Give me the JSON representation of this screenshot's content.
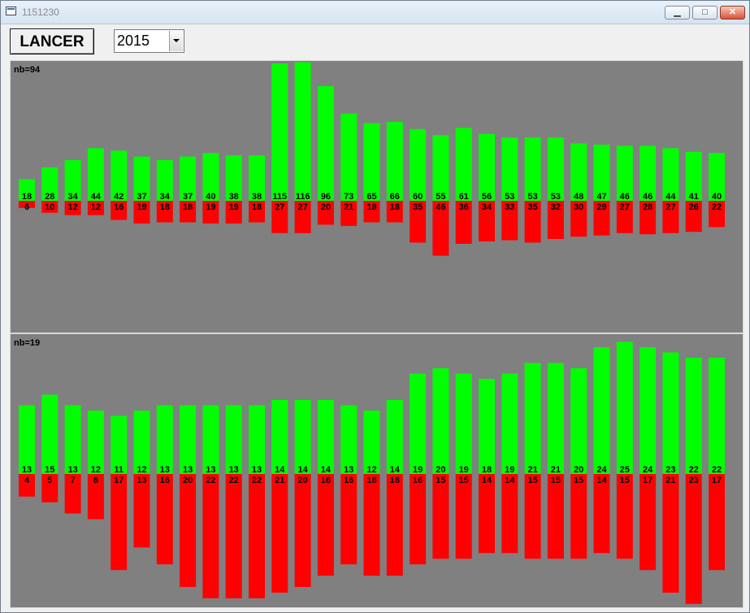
{
  "window": {
    "title": "1151230"
  },
  "toolbar": {
    "button_label": "LANCER",
    "year_selected": "2015"
  },
  "colors": {
    "green": "#00ff00",
    "red": "#ff0000",
    "panel_bg": "#808080"
  },
  "chart_data": [
    {
      "type": "bar",
      "label": "nb=94",
      "green": [
        18,
        28,
        34,
        44,
        42,
        37,
        34,
        37,
        40,
        38,
        38,
        115,
        116,
        96,
        73,
        65,
        66,
        60,
        55,
        61,
        56,
        53,
        53,
        53,
        48,
        47,
        46,
        46,
        44,
        41,
        40
      ],
      "red": [
        6,
        10,
        12,
        12,
        16,
        19,
        18,
        18,
        19,
        19,
        18,
        27,
        27,
        20,
        21,
        18,
        18,
        35,
        46,
        36,
        34,
        33,
        35,
        32,
        30,
        29,
        27,
        28,
        27,
        26,
        22
      ]
    },
    {
      "type": "bar",
      "label": "nb=19",
      "green": [
        13,
        15,
        13,
        12,
        11,
        12,
        13,
        13,
        13,
        13,
        13,
        14,
        14,
        14,
        13,
        12,
        14,
        19,
        20,
        19,
        18,
        19,
        21,
        21,
        20,
        24,
        25,
        24,
        23,
        22,
        22
      ],
      "red": [
        4,
        5,
        7,
        8,
        17,
        13,
        16,
        20,
        22,
        22,
        22,
        21,
        20,
        18,
        16,
        18,
        18,
        16,
        15,
        15,
        14,
        14,
        15,
        15,
        15,
        14,
        15,
        17,
        21,
        23,
        17
      ]
    }
  ]
}
